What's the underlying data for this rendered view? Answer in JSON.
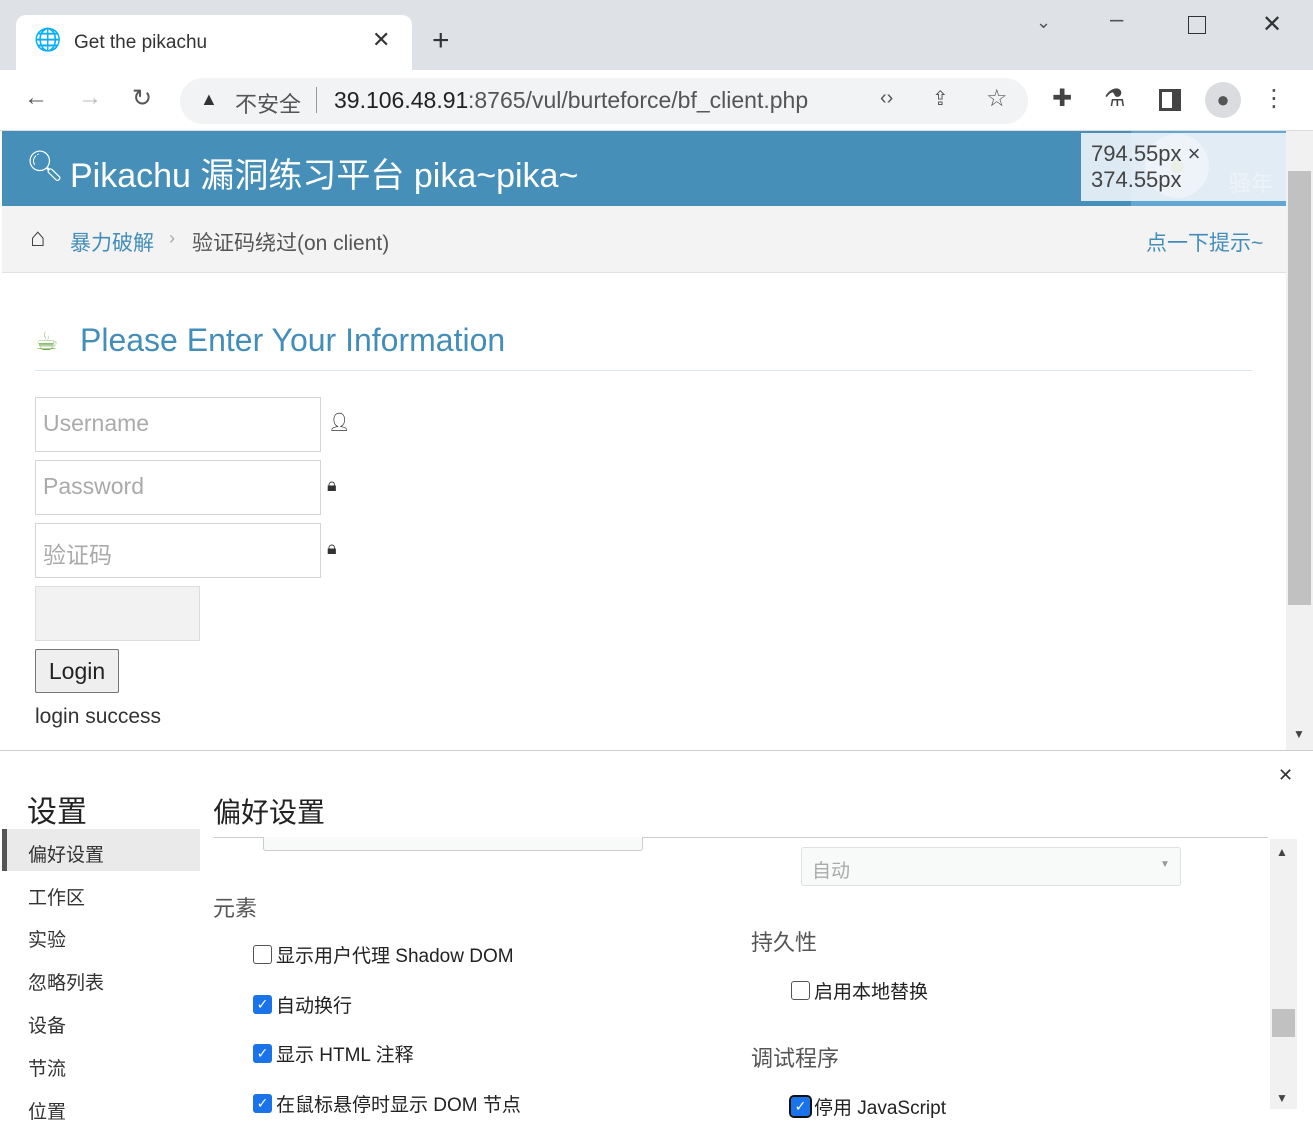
{
  "browser": {
    "tab_title": "Get the pikachu",
    "security_label": "不安全",
    "url_host": "39.106.48.91",
    "url_path": ":8765/vul/burteforce/bf_client.php"
  },
  "page": {
    "site_title": "Pikachu 漏洞练习平台 pika~pika~",
    "user_label": "骚年",
    "dimension_overlay": "794.55px × 374.55px",
    "breadcrumb": {
      "parent": "暴力破解",
      "current": "验证码绕过(on client)",
      "hint": "点一下提示~"
    },
    "form_title": "Please Enter Your Information",
    "username_placeholder": "Username",
    "password_placeholder": "Password",
    "captcha_placeholder": "验证码",
    "login_label": "Login",
    "result": "login success"
  },
  "devtools": {
    "title": "设置",
    "section_title": "偏好设置",
    "nav": [
      "偏好设置",
      "工作区",
      "实验",
      "忽略列表",
      "设备",
      "节流",
      "位置"
    ],
    "select_value": "自动",
    "elements_heading": "元素",
    "elements_options": [
      {
        "label": "显示用户代理 Shadow DOM",
        "checked": false
      },
      {
        "label": "自动换行",
        "checked": true
      },
      {
        "label": "显示 HTML 注释",
        "checked": true
      },
      {
        "label": "在鼠标悬停时显示 DOM 节点",
        "checked": true
      }
    ],
    "persistence_heading": "持久性",
    "persistence_option": {
      "label": "启用本地替换",
      "checked": false
    },
    "debugger_heading": "调试程序",
    "debugger_option": {
      "label": "停用 JavaScript",
      "checked": true
    }
  }
}
